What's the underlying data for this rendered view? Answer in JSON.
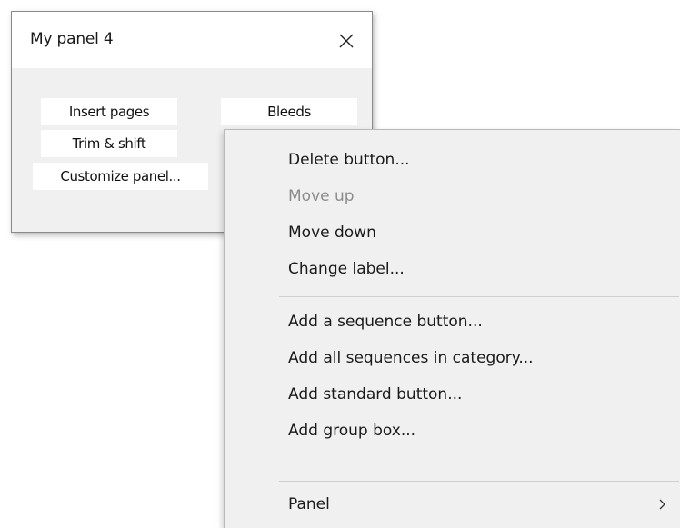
{
  "panel": {
    "title": "My panel 4",
    "close_icon": "close-icon",
    "buttons": [
      "Insert pages",
      "Bleeds",
      "Trim & shift",
      "Customize panel..."
    ]
  },
  "context_menu": {
    "items": [
      {
        "label": "Delete button...",
        "enabled": true
      },
      {
        "label": "Move up",
        "enabled": false
      },
      {
        "label": "Move down",
        "enabled": true
      },
      {
        "label": "Change label...",
        "enabled": true
      },
      {
        "label": "Add a sequence button...",
        "enabled": true
      },
      {
        "label": "Add all sequences in category...",
        "enabled": true
      },
      {
        "label": "Add standard button...",
        "enabled": true
      },
      {
        "label": "Add group box...",
        "enabled": true
      },
      {
        "label": "Panel",
        "enabled": true,
        "has_submenu": true
      }
    ],
    "submenu_icon": "chevron-right-icon"
  },
  "colors": {
    "menu_background": "#f0f0f0",
    "disabled_text": "#8c8c8c",
    "panel_background": "#f0f0f0"
  }
}
